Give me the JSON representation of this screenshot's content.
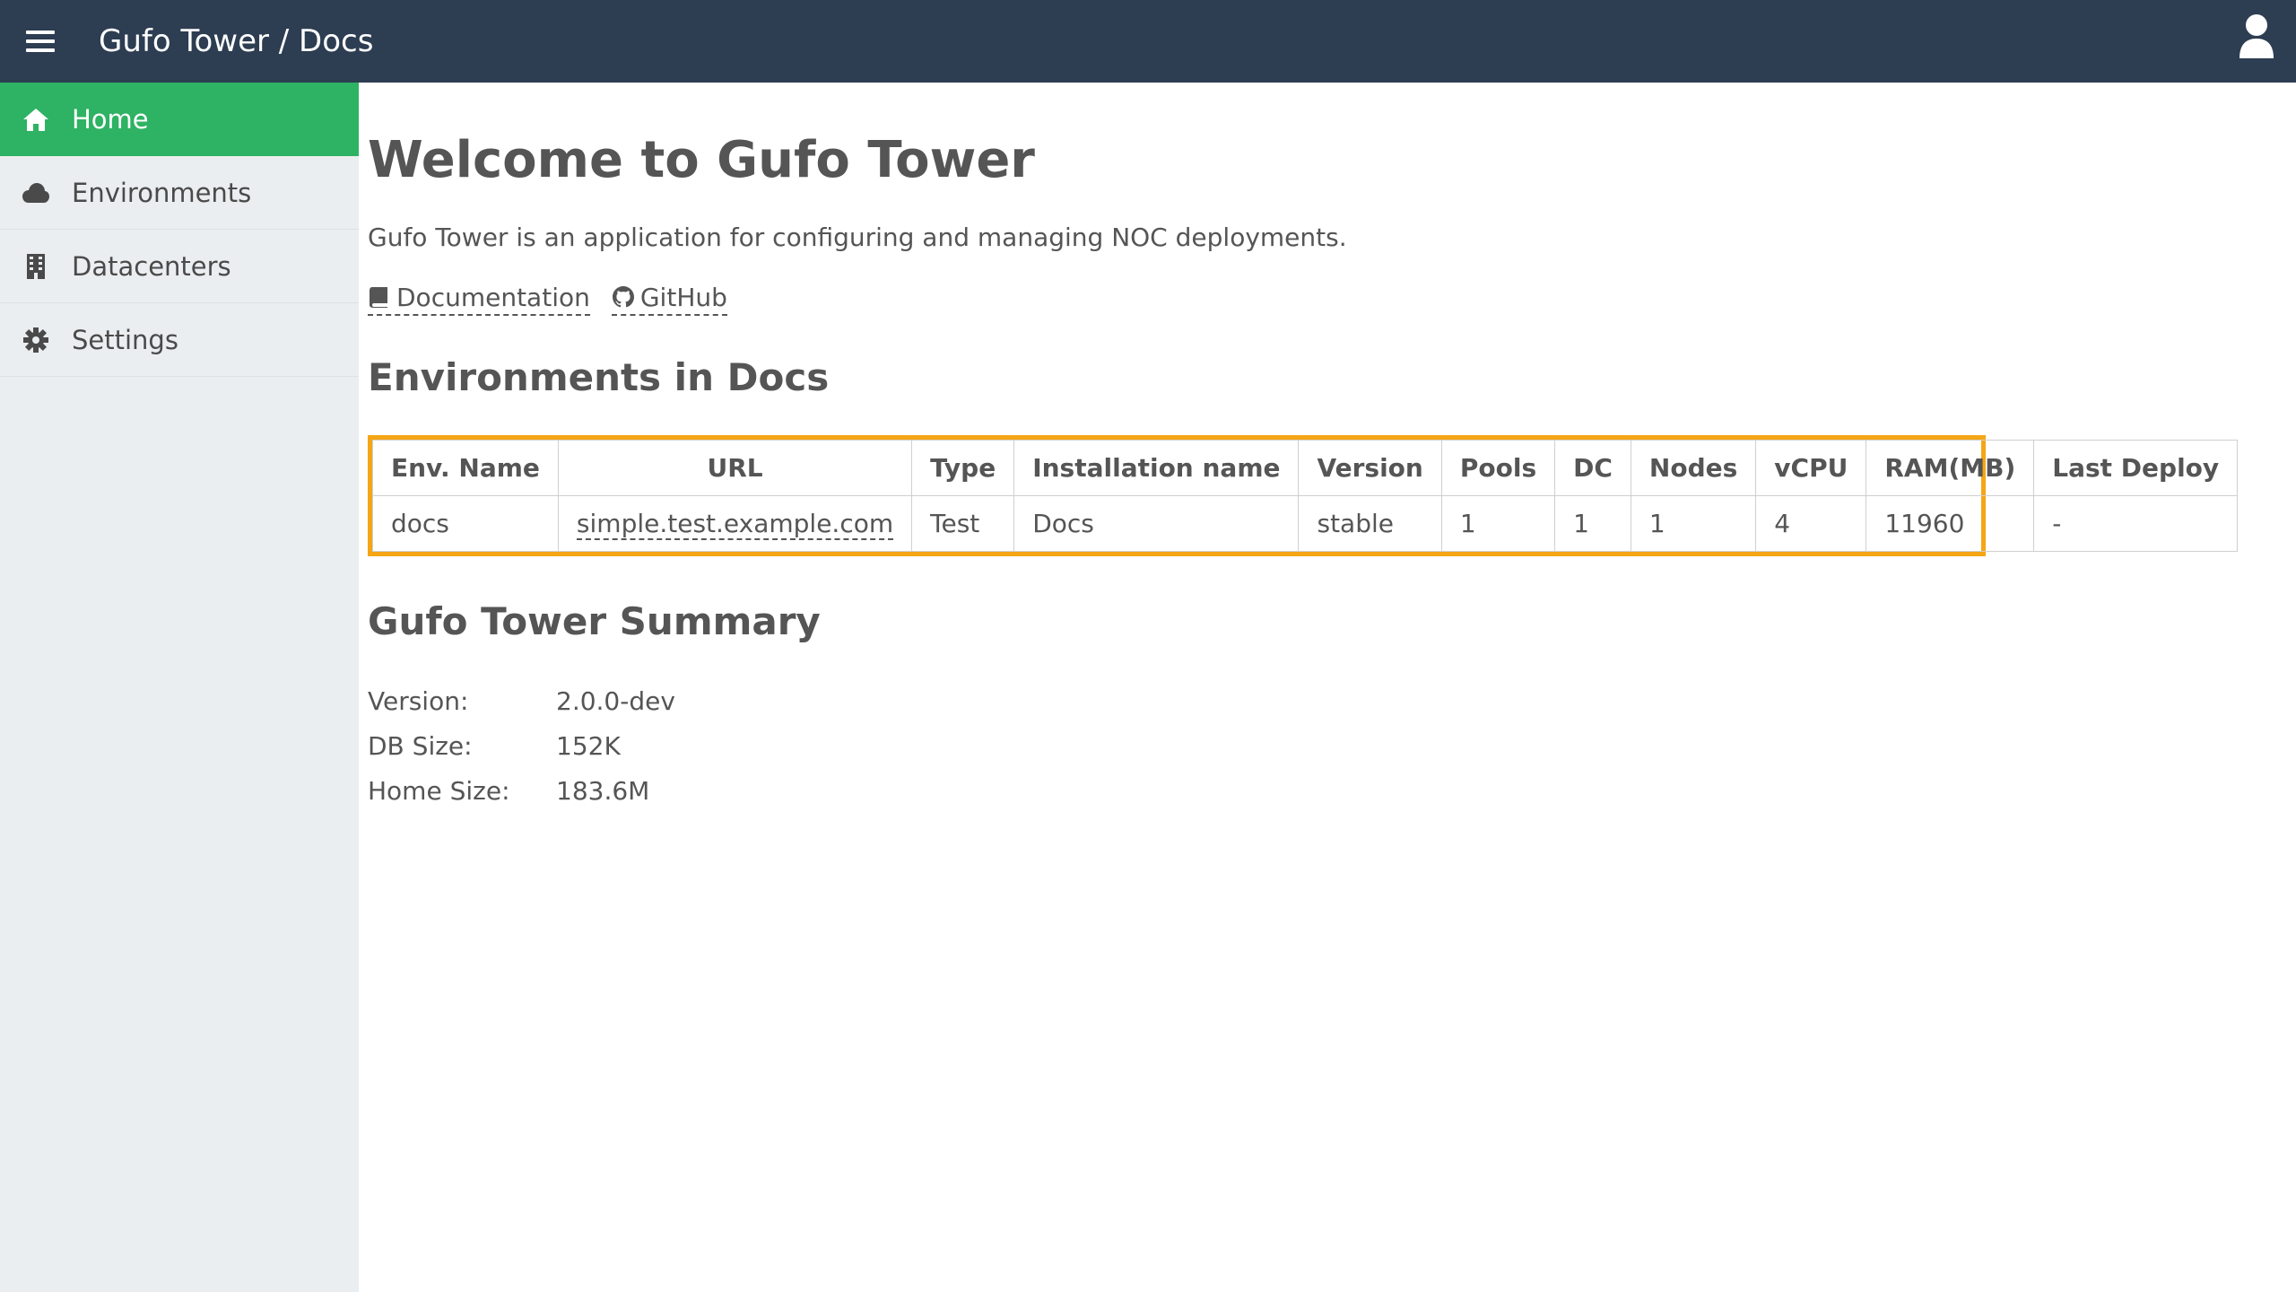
{
  "header": {
    "title": "Gufo Tower / Docs",
    "menu_icon": "hamburger-icon",
    "user_icon": "user-icon"
  },
  "sidebar": {
    "items": [
      {
        "label": "Home",
        "icon": "home-icon",
        "active": true
      },
      {
        "label": "Environments",
        "icon": "cloud-icon",
        "active": false
      },
      {
        "label": "Datacenters",
        "icon": "building-icon",
        "active": false
      },
      {
        "label": "Settings",
        "icon": "gear-icon",
        "active": false
      }
    ]
  },
  "main": {
    "title": "Welcome to Gufo Tower",
    "intro": "Gufo Tower is an application for configuring and managing NOC deployments.",
    "links": {
      "documentation": "Documentation",
      "github": "GitHub"
    },
    "env_section_title": "Environments in Docs",
    "env_table": {
      "headers": [
        "Env. Name",
        "URL",
        "Type",
        "Installation name",
        "Version",
        "Pools",
        "DC",
        "Nodes",
        "vCPU",
        "RAM(MB)",
        "Last Deploy"
      ],
      "rows": [
        [
          "docs",
          "simple.test.example.com",
          "Test",
          "Docs",
          "stable",
          "1",
          "1",
          "1",
          "4",
          "11960",
          "-"
        ]
      ]
    },
    "summary_title": "Gufo Tower Summary",
    "summary": {
      "version_label": "Version:",
      "version_value": "2.0.0-dev",
      "db_size_label": "DB Size:",
      "db_size_value": "152K",
      "home_size_label": "Home Size:",
      "home_size_value": "183.6M"
    }
  },
  "colors": {
    "topbar": "#2d3d52",
    "sidebar": "#ebeef0",
    "active": "#2eb263",
    "highlight": "#f5a515"
  }
}
